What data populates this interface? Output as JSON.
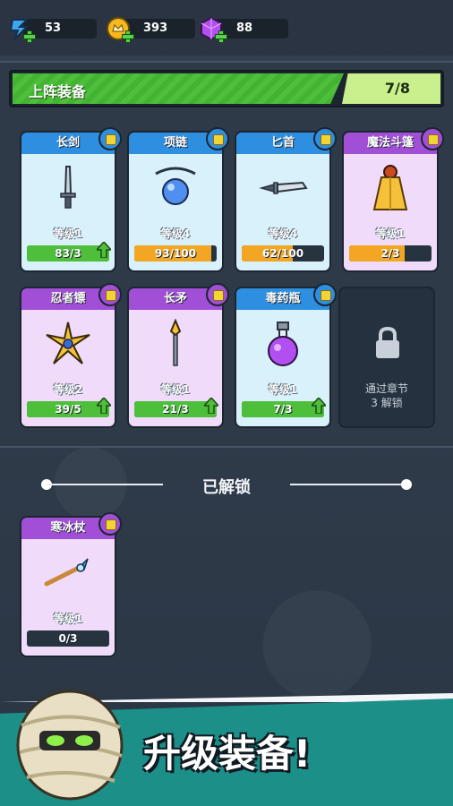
{
  "resources": [
    {
      "name": "energy",
      "value": "53"
    },
    {
      "name": "gold",
      "value": "393"
    },
    {
      "name": "gems",
      "value": "88"
    }
  ],
  "equipped_header": {
    "title": "上阵装备",
    "count": "7/8"
  },
  "equipped": [
    {
      "name": "长剑",
      "level": "等级1",
      "progress": "83/3",
      "rarity": "blue",
      "fill": 1.0,
      "fill_color": "#4ebf3a",
      "upgradable": true
    },
    {
      "name": "项链",
      "level": "等级4",
      "progress": "93/100",
      "rarity": "blue",
      "fill": 0.93,
      "fill_color": "#f2a623",
      "upgradable": false
    },
    {
      "name": "匕首",
      "level": "等级4",
      "progress": "62/100",
      "rarity": "blue",
      "fill": 0.62,
      "fill_color": "#f2a623",
      "upgradable": false
    },
    {
      "name": "魔法斗篷",
      "level": "等级1",
      "progress": "2/3",
      "rarity": "purple",
      "fill": 0.67,
      "fill_color": "#f2a623",
      "upgradable": false
    },
    {
      "name": "忍者镖",
      "level": "等级2",
      "progress": "39/5",
      "rarity": "purple",
      "fill": 1.0,
      "fill_color": "#4ebf3a",
      "upgradable": true
    },
    {
      "name": "长矛",
      "level": "等级1",
      "progress": "21/3",
      "rarity": "purple",
      "fill": 1.0,
      "fill_color": "#4ebf3a",
      "upgradable": true
    },
    {
      "name": "毒药瓶",
      "level": "等级1",
      "progress": "7/3",
      "rarity": "blue",
      "fill": 1.0,
      "fill_color": "#4ebf3a",
      "upgradable": true
    }
  ],
  "locked_slot": {
    "line1": "通过章节",
    "line2": "3 解锁"
  },
  "unlocked_label": "已解锁",
  "unlocked": [
    {
      "name": "寒冰杖",
      "level": "等级1",
      "progress": "0/3",
      "rarity": "purple",
      "fill": 0.0
    }
  ],
  "promo_title": "升级装备!"
}
